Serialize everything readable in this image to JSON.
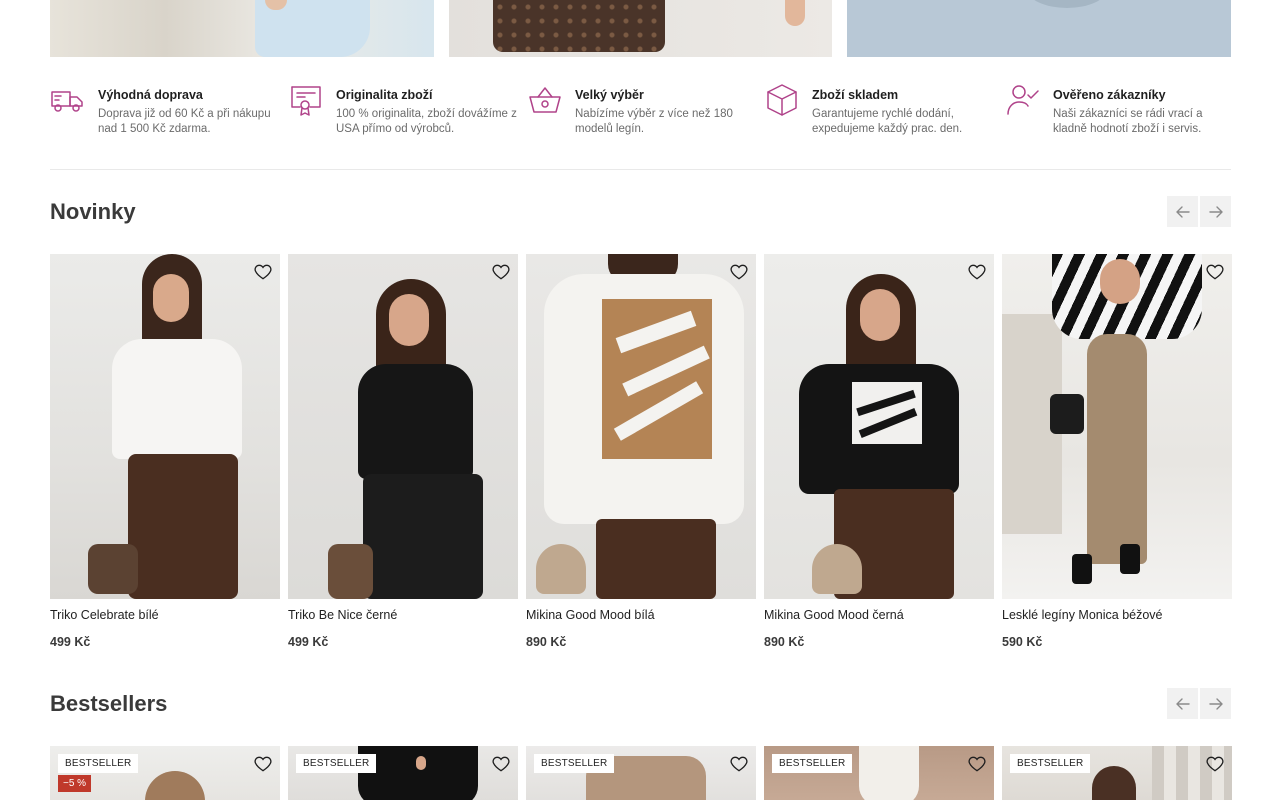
{
  "benefits": [
    {
      "icon": "truck-icon",
      "title": "Výhodná doprava",
      "desc_line1": "Doprava již od 60 Kč a při nákupu",
      "desc_line2": "nad 1 500 Kč zdarma."
    },
    {
      "icon": "certificate-icon",
      "title": "Originalita zboží",
      "desc_line1": "100 % originalita, zboží dovážíme z",
      "desc_line2": "USA přímo od výrobců."
    },
    {
      "icon": "basket-icon",
      "title": "Velký výběr",
      "desc_line1": "Nabízíme výběr z více než 180",
      "desc_line2": "modelů legín."
    },
    {
      "icon": "box-icon",
      "title": "Zboží skladem",
      "desc_line1": "Garantujeme rychlé dodání,",
      "desc_line2": "expedujeme každý prac. den."
    },
    {
      "icon": "verified-user-icon",
      "title": "Ověřeno zákazníky",
      "desc_line1": "Naši zákazníci se rádi vrací a",
      "desc_line2": "kladně hodnotí zboží i servis."
    }
  ],
  "novinky": {
    "title": "Novinky",
    "products": [
      {
        "name": "Triko Celebrate bílé",
        "price": "499 Kč"
      },
      {
        "name": "Triko Be Nice černé",
        "price": "499 Kč"
      },
      {
        "name": "Mikina Good Mood bílá",
        "price": "890 Kč"
      },
      {
        "name": "Mikina Good Mood černá",
        "price": "890 Kč"
      },
      {
        "name": "Lesklé legíny Monica béžové",
        "price": "590 Kč"
      }
    ]
  },
  "bestsellers": {
    "title": "Bestsellers",
    "badge": "BESTSELLER",
    "discount": "−5 %"
  },
  "colors": {
    "accent": "#b0438a",
    "discount": "#c0392b"
  }
}
